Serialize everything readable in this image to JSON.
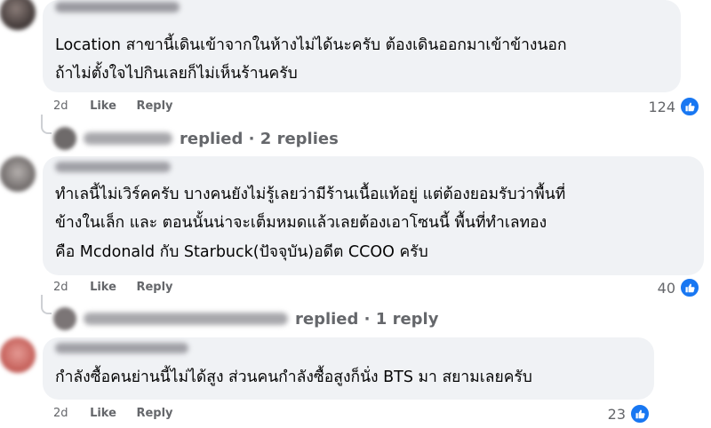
{
  "comments": [
    {
      "lines": [
        "Location สาขานี้เดินเข้าจากในห้างไม่ได้นะครับ ต้องเดินออกมาเข้าข้างนอก",
        "ถ้าไม่ตั้งใจไปกินเลยก็ไม่เห็นร้านครับ"
      ],
      "age": "2d",
      "like_label": "Like",
      "reply_label": "Reply",
      "reaction_count": "124",
      "replies_text": "replied · 2 replies"
    },
    {
      "lines": [
        "ทำเลนี้ไม่เวิร์คครับ บางคนยังไม่รู้เลยว่ามีร้านเนื้อแท้อยู่ แต่ต้องยอมรับว่าพื้นที่",
        "ข้างในเล็ก และ ตอนนั้นน่าจะเต็มหมดแล้วเลยต้องเอาโซนนี้ พื้นที่ทำเลทอง",
        "คือ Mcdonald กับ Starbuck(ปัจจุบัน)อดีต CCOO ครับ"
      ],
      "age": "2d",
      "like_label": "Like",
      "reply_label": "Reply",
      "reaction_count": "40",
      "replies_text": "replied · 1 reply"
    },
    {
      "lines": [
        "กำลังซื้อคนย่านนี้ไม่ได้สูง ส่วนคนกำลังซื้อสูงก็นั่ง BTS มา สยามเลยครับ"
      ],
      "age": "2d",
      "like_label": "Like",
      "reply_label": "Reply",
      "reaction_count": "23"
    }
  ],
  "colors": {
    "bubble": "#f0f2f5",
    "meta_text": "#65676b",
    "like_badge": "#1877f2"
  },
  "icons": {
    "reaction": "thumbs-up-icon"
  }
}
